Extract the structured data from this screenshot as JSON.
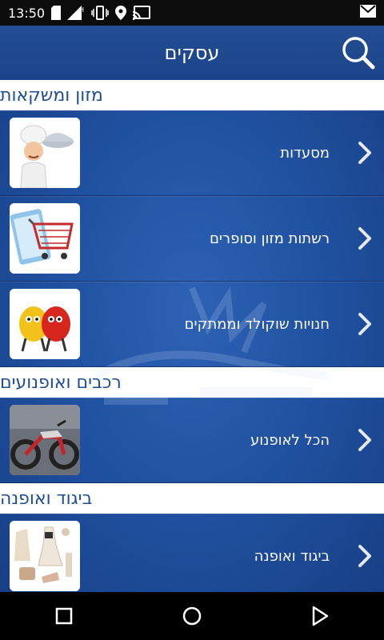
{
  "status_bar": {
    "time": "13:50",
    "icons": [
      "sd-card-icon",
      "signal-h-icon",
      "vibrate-icon",
      "location-icon",
      "cast-icon",
      "gmail-icon"
    ]
  },
  "header": {
    "title": "עסקים",
    "search_icon": "search-icon"
  },
  "sections": [
    {
      "title": "מזון ומשקאות",
      "items": [
        {
          "label": "מסעדות",
          "thumb": "chef-image"
        },
        {
          "label": "רשתות מזון וסופרים",
          "thumb": "shopping-cart-image"
        },
        {
          "label": "חנויות שוקולד וממתקים",
          "thumb": "candy-characters-image"
        }
      ]
    },
    {
      "title": "רכבים ואופנועים",
      "items": [
        {
          "label": "הכל לאופנוע",
          "thumb": "motorcycle-image"
        }
      ]
    },
    {
      "title": "ביגוד ואופנה",
      "items": [
        {
          "label": "ביגוד ואופנה",
          "thumb": "fashion-collage-image"
        }
      ]
    }
  ],
  "navbar": {
    "buttons": [
      "recent-apps-button",
      "home-button",
      "back-button"
    ]
  },
  "colors": {
    "header_bg": "#1f4a90",
    "content_bg": "#1f4f9e",
    "section_text": "#1f4d93",
    "status_bar": "#0c0c0c"
  }
}
